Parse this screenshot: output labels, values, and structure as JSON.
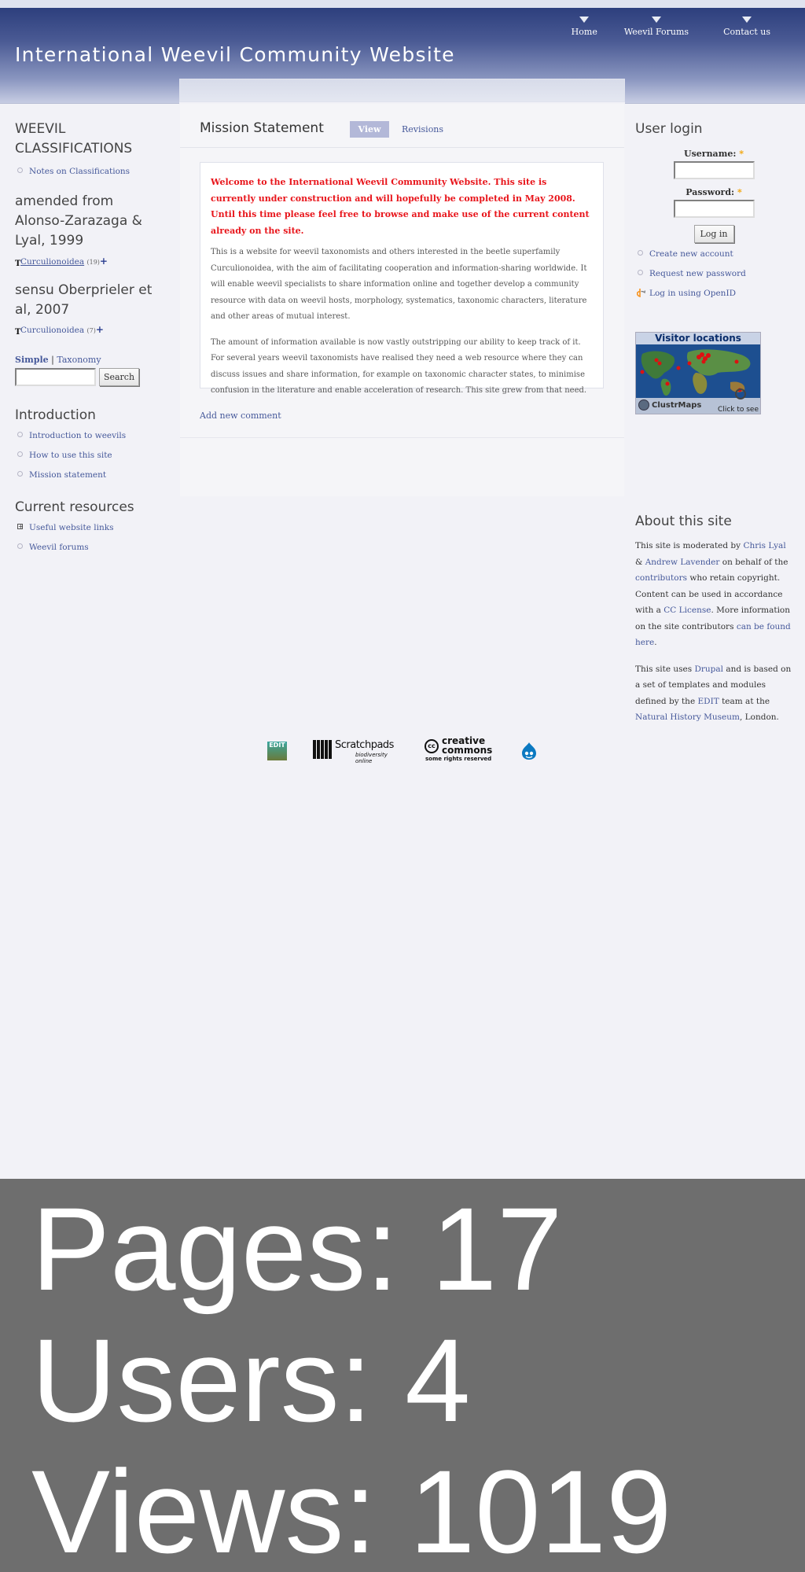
{
  "site": {
    "title": "International Weevil Community Website"
  },
  "primary_nav": [
    {
      "label": "Home"
    },
    {
      "label": "Weevil Forums"
    },
    {
      "label": "Contact us"
    }
  ],
  "left_sidebar": {
    "classifications": {
      "title": "WEEVIL CLASSIFICATIONS",
      "items": [
        {
          "label": "Notes on Classifications"
        }
      ]
    },
    "taxonomy_alonso": {
      "title": "amended from Alonso-Zarazaga & Lyal, 1999",
      "term": "Curculionoidea",
      "count": "(19)"
    },
    "taxonomy_oberprieler": {
      "title": "sensu Oberprieler et al, 2007",
      "term": "Curculionoidea",
      "count": "(7)"
    },
    "search": {
      "tab_simple": "Simple",
      "separator": "|",
      "tab_taxonomy": "Taxonomy",
      "input_value": "",
      "button_label": "Search"
    },
    "introduction": {
      "title": "Introduction",
      "items": [
        {
          "label": "Introduction to weevils"
        },
        {
          "label": "How to use this site"
        },
        {
          "label": "Mission statement"
        }
      ]
    },
    "current_resources": {
      "title": "Current resources",
      "items": [
        {
          "label": "Useful website links"
        },
        {
          "label": "Weevil forums"
        }
      ]
    }
  },
  "main": {
    "title": "Mission Statement",
    "tabs": [
      {
        "label": "View",
        "active": true
      },
      {
        "label": "Revisions",
        "active": false
      }
    ],
    "intro": "Welcome to the International Weevil Community Website. This site is currently under construction and will hopefully be completed in May 2008. Until this time please feel free to browse and make use of the current content already on the site.",
    "paragraphs": [
      "This is a website for weevil taxonomists and others interested in the beetle superfamily Curculionoidea, with the aim of facilitating cooperation and information-sharing worldwide. It will enable weevil specialists to share information online and together develop a community resource with data on weevil hosts, morphology, systematics, taxonomic characters, literature and other areas of mutual interest.",
      "The amount of information available is now vastly outstripping our ability to keep track of it. For several years weevil taxonomists have realised they need a web resource where they can discuss issues and share information, for example on taxonomic character states, to minimise confusion in the literature and enable acceleration of research. This site grew from that need."
    ],
    "add_comment": "Add new comment"
  },
  "right_sidebar": {
    "login": {
      "title": "User login",
      "username_label": "Username:",
      "password_label": "Password:",
      "required_mark": "*",
      "username_value": "",
      "password_value": "",
      "button_label": "Log in",
      "links": [
        {
          "label": "Create new account"
        },
        {
          "label": "Request new password"
        },
        {
          "label": "Log in using OpenID"
        }
      ]
    },
    "visitor_map": {
      "title": "Visitor locations",
      "brand": "ClustrMaps",
      "cta": "Click to see"
    },
    "about": {
      "title": "About this site",
      "p1": {
        "t1": "This site is moderated by ",
        "link1": "Chris Lyal",
        "t2": " & ",
        "link2": "Andrew Lavender",
        "t3": " on behalf of the ",
        "link3": "contributors",
        "t4": " who retain copyright. Content can be used in accordance with a ",
        "link4": "CC License",
        "t5": ". More information on the site contributors ",
        "link5": "can be found here",
        "t6": "."
      },
      "p2": {
        "t1": "This site uses ",
        "link1": "Drupal",
        "t2": " and is based on a set of templates and modules defined by the ",
        "link2": "EDIT",
        "t3": " team at the ",
        "link3": "Natural History Museum",
        "t4": ", London."
      }
    }
  },
  "footer_logos": {
    "edit": "EDIT",
    "scratchpads": "Scratchpads",
    "scratchpads_sub": "biodiversity online",
    "cc_main": "creative",
    "cc_main2": "commons",
    "cc_sub": "some rights reserved"
  },
  "stats": [
    {
      "label": "Pages: 17"
    },
    {
      "label": "Users: 4"
    },
    {
      "label": "Views: 1019"
    }
  ],
  "colors": {
    "header_top": "#2d3f7d",
    "link": "#45589a",
    "intro_red": "#e8151b",
    "overlay_gray": "#6e6e6e"
  }
}
